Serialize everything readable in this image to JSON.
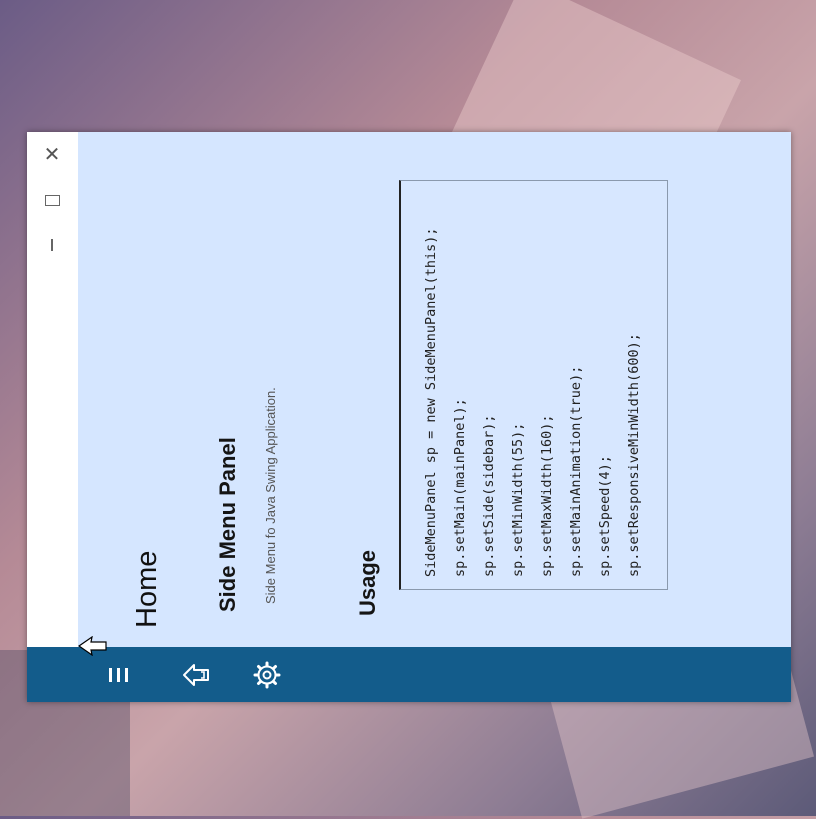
{
  "window": {
    "controls": {
      "close": "✕",
      "maximize": "maximize",
      "minimize": "minimize"
    },
    "app_icon": "java-app-icon"
  },
  "sidebar": {
    "items": [
      {
        "icon": "hamburger-menu-icon"
      },
      {
        "icon": "home-icon"
      },
      {
        "icon": "gear-icon"
      }
    ],
    "background": "#135c8b"
  },
  "main": {
    "title": "Home",
    "panel_title": "Side Menu Panel",
    "panel_subtitle": "Side Menu fo Java Swing Application.",
    "usage_title": "Usage",
    "code_lines": [
      "SideMenuPanel sp = new SideMenuPanel(this);",
      "sp.setMain(mainPanel);",
      "sp.setSide(sidebar);",
      "sp.setMinWidth(55);",
      "sp.setMaxWidth(160);",
      "sp.setMainAnimation(true);",
      "sp.setSpeed(4);",
      "sp.setResponsiveMinWidth(600);"
    ],
    "background": "#d5e6ff"
  }
}
